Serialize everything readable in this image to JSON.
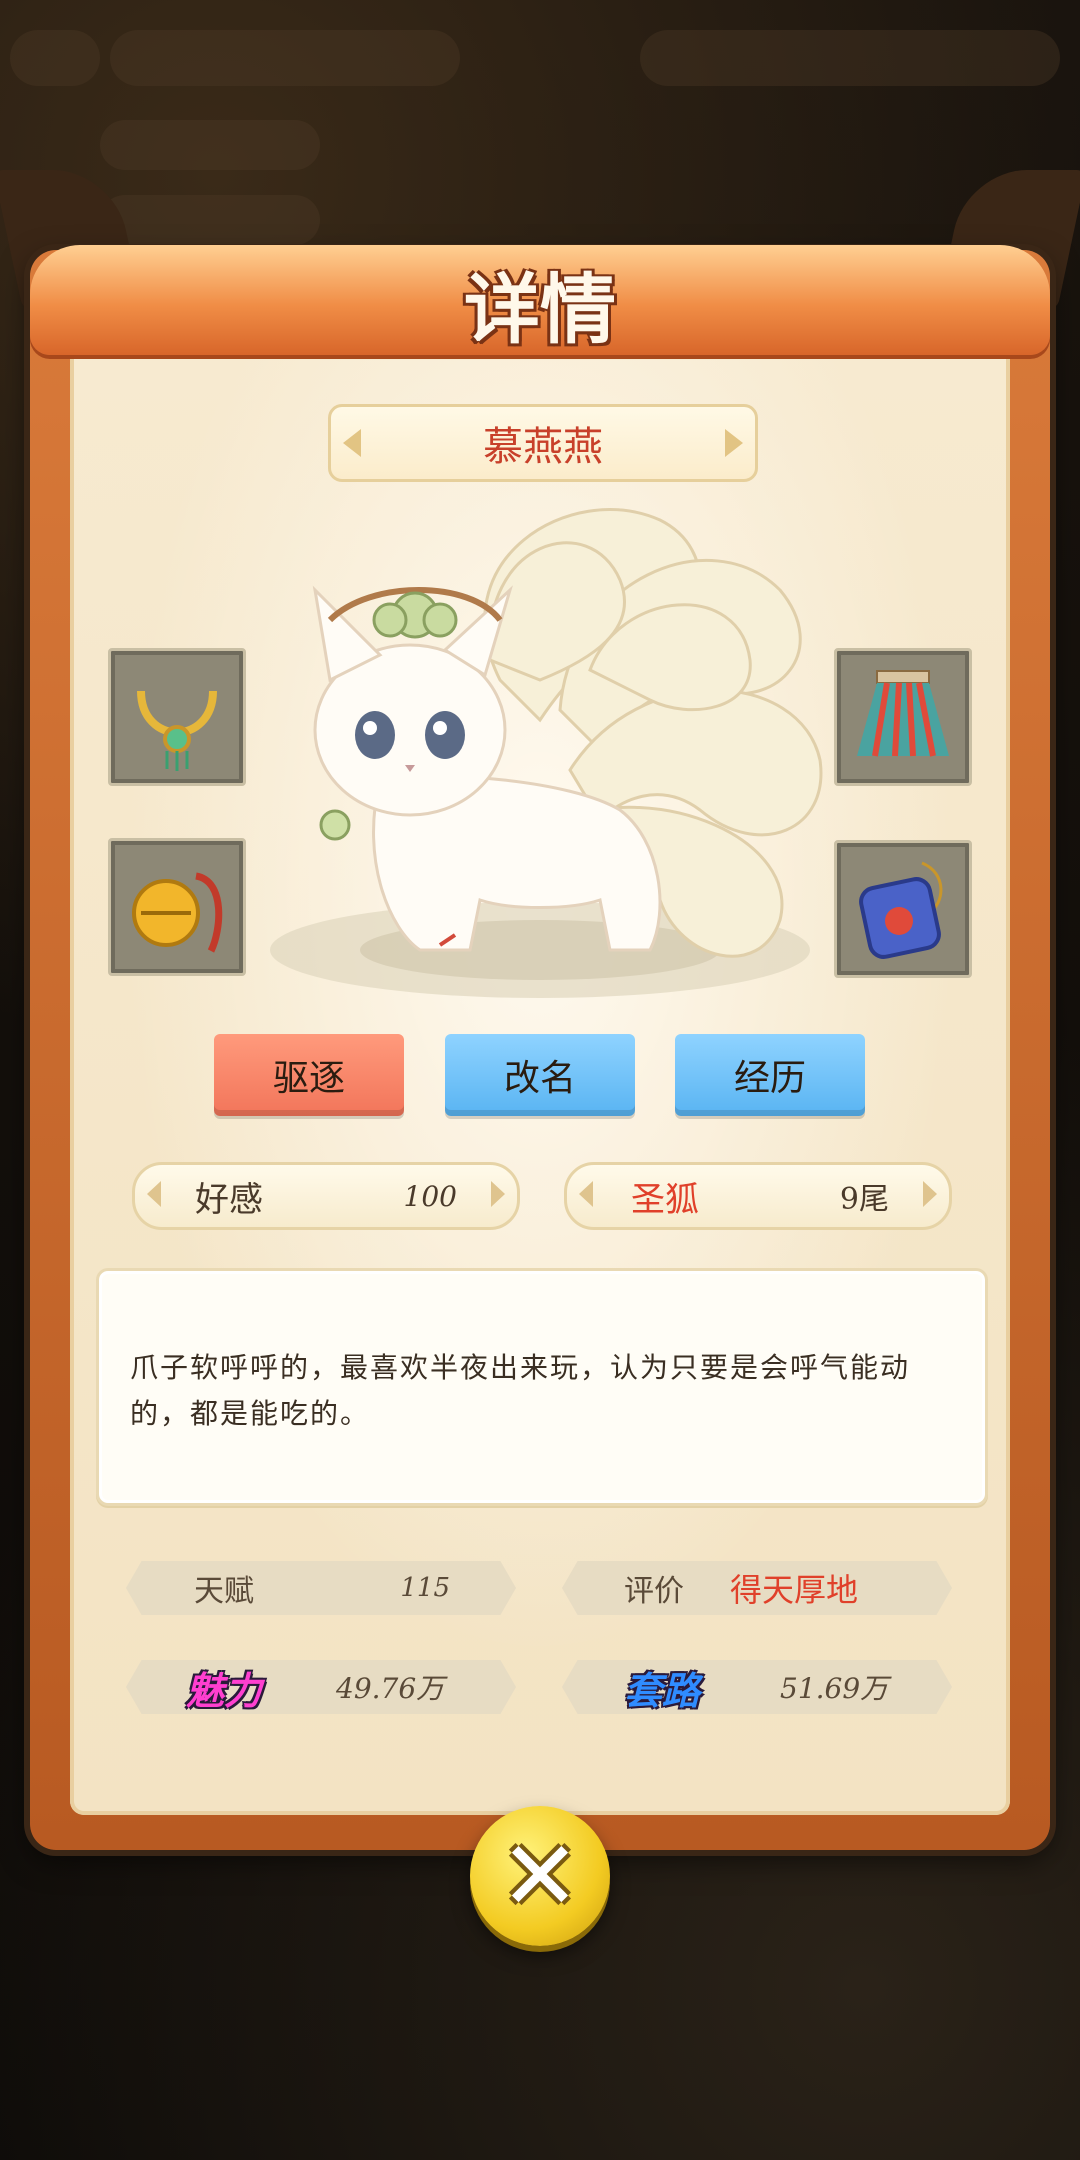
{
  "dialog": {
    "title": "详情",
    "pet_name": "慕燕燕"
  },
  "actions": {
    "expel_label": "驱逐",
    "rename_label": "改名",
    "history_label": "经历"
  },
  "stats": {
    "affection_label": "好感",
    "affection_value": "100",
    "rank_label": "圣狐",
    "tails_value": "9尾"
  },
  "description": "爪子软呼呼的，最喜欢半夜出来玩，认为只要是会呼气能动的，都是能吃的。",
  "attributes": {
    "talent_label": "天赋",
    "talent_value": "115",
    "rating_label": "评价",
    "rating_value": "得天厚地",
    "charm_label": "魅力",
    "charm_value": "49.76万",
    "scheme_label": "套路",
    "scheme_value": "51.69万"
  },
  "equipment": {
    "slot_top_left": "necklace-icon",
    "slot_bottom_left": "bell-icon",
    "slot_top_right": "skirt-icon",
    "slot_bottom_right": "sachet-icon"
  },
  "colors": {
    "title_orange": "#f08d46",
    "expel_red": "#f2755a",
    "button_blue": "#59b4f2",
    "name_red": "#c8402a",
    "charm_magenta": "#ff3fd0",
    "scheme_blue": "#2f8cff"
  }
}
